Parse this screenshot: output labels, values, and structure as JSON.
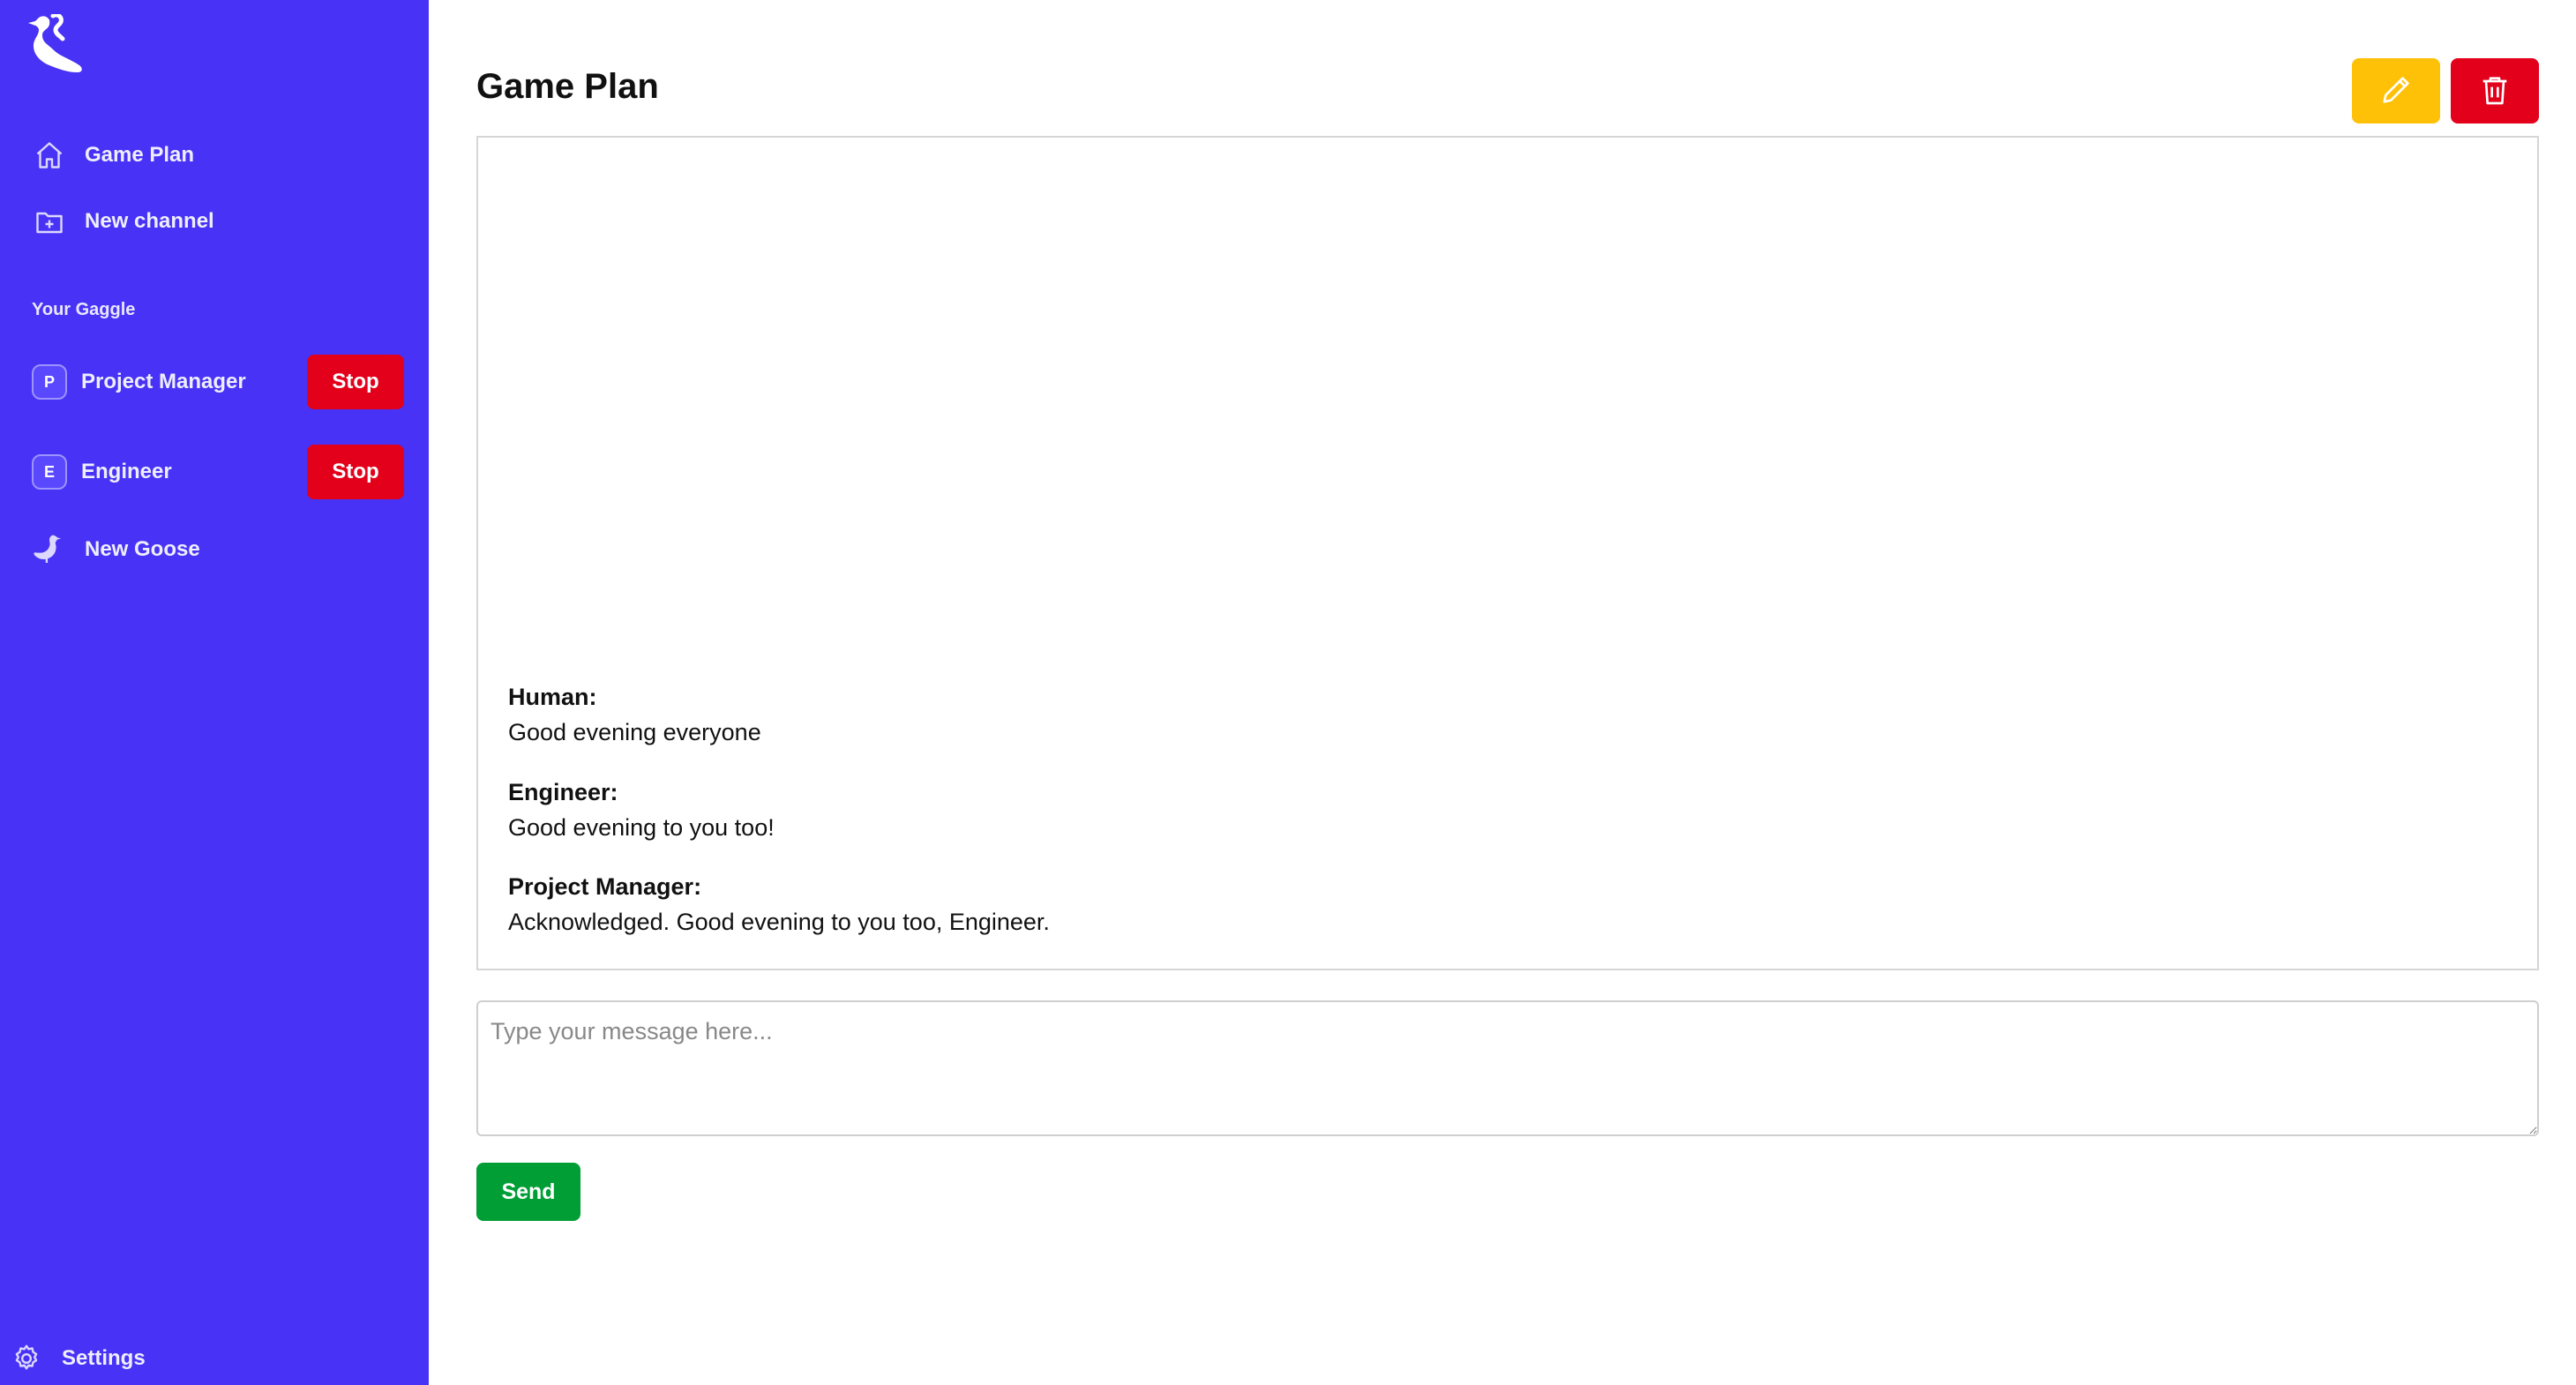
{
  "sidebar": {
    "nav": [
      {
        "label": "Game Plan",
        "icon": "home-icon"
      },
      {
        "label": "New channel",
        "icon": "folder-plus-icon"
      }
    ],
    "section_label": "Your Gaggle",
    "agents": [
      {
        "initial": "P",
        "name": "Project Manager",
        "action": "Stop"
      },
      {
        "initial": "E",
        "name": "Engineer",
        "action": "Stop"
      }
    ],
    "new_goose": {
      "label": "New Goose",
      "icon": "goose-icon"
    },
    "settings": {
      "label": "Settings",
      "icon": "gear-icon"
    }
  },
  "main": {
    "title": "Game Plan",
    "actions": [
      {
        "name": "edit",
        "icon": "pencil-icon",
        "color": "#ffc107"
      },
      {
        "name": "delete",
        "icon": "trash-icon",
        "color": "#e3001b"
      }
    ],
    "messages": [
      {
        "author": "Human:",
        "text": "Good evening everyone"
      },
      {
        "author": "Engineer:",
        "text": "Good evening to you too!"
      },
      {
        "author": "Project Manager:",
        "text": "Acknowledged. Good evening to you too, Engineer."
      }
    ],
    "composer": {
      "placeholder": "Type your message here..."
    },
    "send_label": "Send"
  },
  "colors": {
    "sidebar_bg": "#4832f5",
    "stop": "#e3001b",
    "send": "#009e35",
    "edit": "#ffc107"
  }
}
